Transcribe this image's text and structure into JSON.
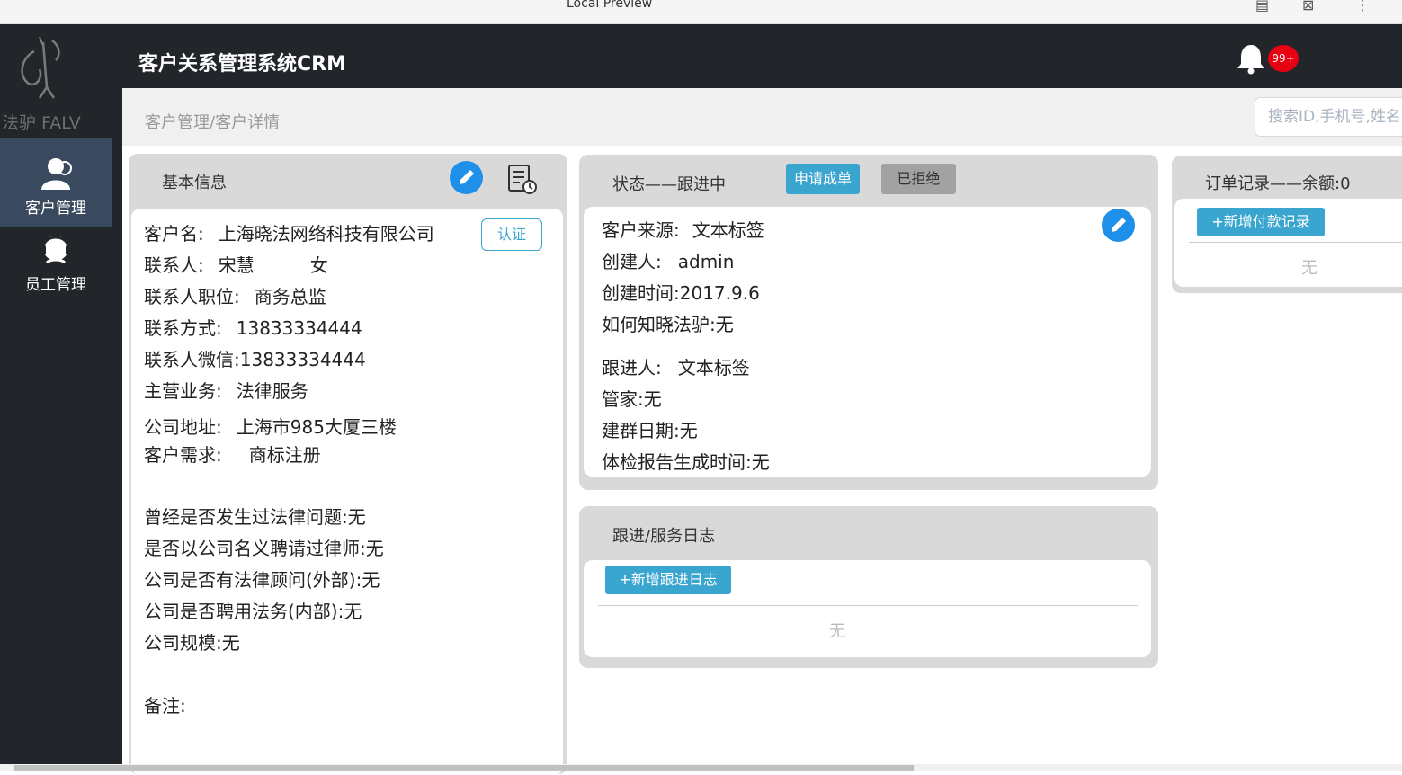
{
  "preview": {
    "title": "Local Preview",
    "icons": [
      "document-icon",
      "close-tab-icon",
      "more-vertical-icon"
    ]
  },
  "sidebar": {
    "logo_text": "法驴 FALV",
    "items": [
      {
        "label": "客户管理",
        "icon": "customers-icon",
        "active": true
      },
      {
        "label": "员工管理",
        "icon": "staff-icon",
        "active": false
      }
    ]
  },
  "header": {
    "title": "客户关系管理系统CRM",
    "notification_count": "99+"
  },
  "subbar": {
    "breadcrumb": "客户管理/客户详情",
    "search_placeholder": "搜索ID,手机号,姓名"
  },
  "basic_info": {
    "title": "基本信息",
    "verify_label": "认证",
    "fields": [
      {
        "label": "客户名:",
        "value": "上海晓法网络科技有限公司"
      },
      {
        "label": "联系人:",
        "value": "宋慧",
        "extra": "女"
      },
      {
        "label": "联系人职位:",
        "value": "商务总监"
      },
      {
        "label": "联系方式:",
        "value": "13833334444"
      },
      {
        "label": "联系人微信:",
        "value": "13833334444"
      },
      {
        "label": "主营业务:",
        "value": "法律服务"
      },
      {
        "label": "公司地址:",
        "value": "上海市985大厦三楼"
      },
      {
        "label": "客户需求:",
        "value": "商标注册"
      }
    ],
    "questions": [
      "曾经是否发生过法律问题:无",
      "是否以公司名义聘请过律师:无",
      "公司是否有法律顾问(外部):无",
      "公司是否聘用法务(内部):无",
      "公司规模:无"
    ],
    "remark": "备注:"
  },
  "status": {
    "title": "状态——跟进中",
    "apply_label": "申请成单",
    "rejected_label": "已拒绝",
    "fields": [
      {
        "label": "客户来源:",
        "value": "文本标签"
      },
      {
        "label": "创建人:",
        "value": "admin"
      },
      {
        "label": "创建时间:",
        "value": "2017.9.6"
      },
      {
        "label": "如何知晓法驴:",
        "value": "无"
      },
      {
        "label": "跟进人:",
        "value": "文本标签"
      },
      {
        "label": "管家:",
        "value": "无"
      },
      {
        "label": "建群日期:",
        "value": "无"
      },
      {
        "label": "体检报告生成时间:",
        "value": "无"
      }
    ]
  },
  "log": {
    "title": "跟进/服务日志",
    "add_label": "+新增跟进日志",
    "empty": "无"
  },
  "orders": {
    "title": "订单记录——余额:0",
    "add_label": "+新增付款记录",
    "empty": "无"
  },
  "colors": {
    "accent": "#1e90ea",
    "button": "#3aa5cf",
    "dark": "#22262b",
    "badge": "#e60012"
  }
}
